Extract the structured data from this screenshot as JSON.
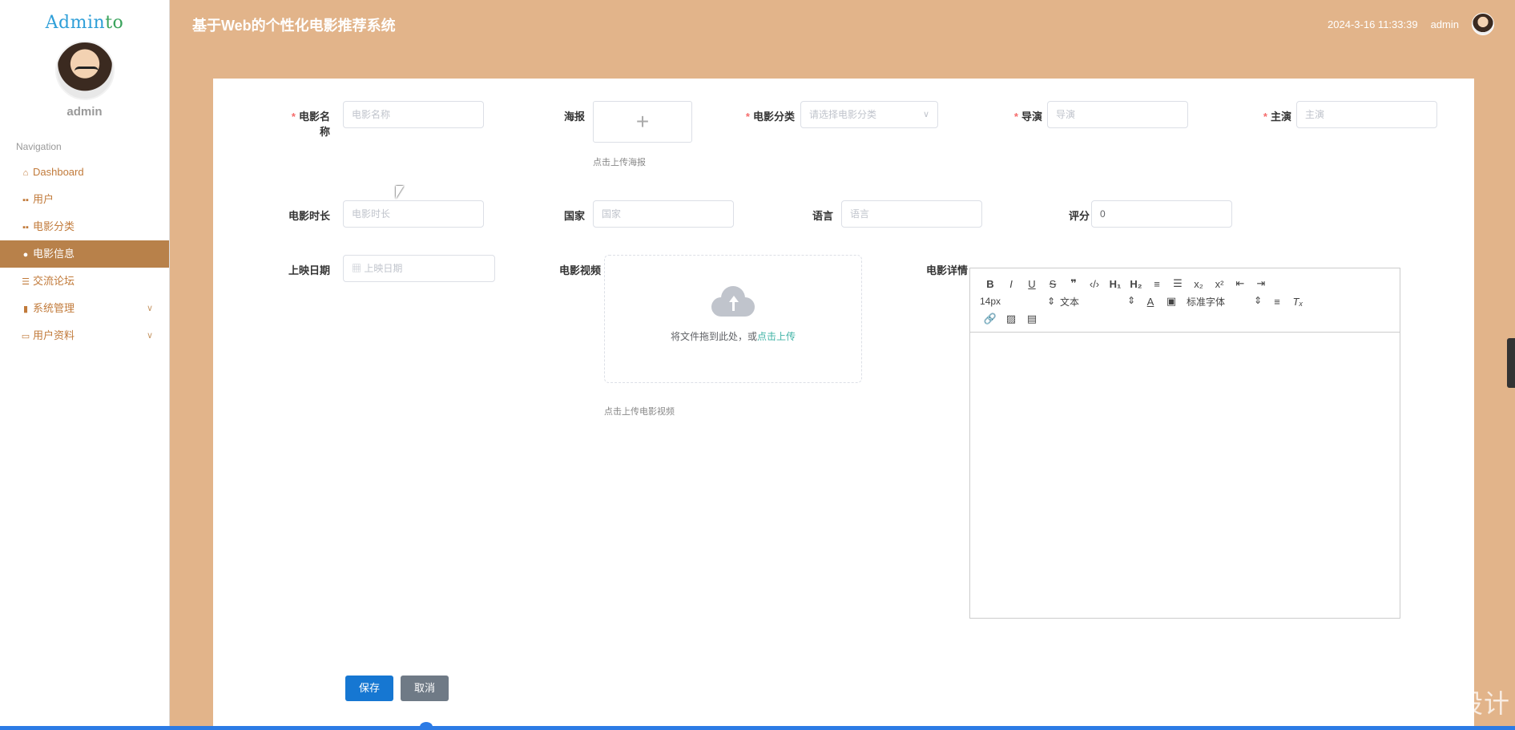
{
  "sidebar": {
    "logo_main": "Admin",
    "logo_accent": "to",
    "user_name": "admin",
    "nav_title": "Navigation",
    "items": [
      {
        "label": "Dashboard",
        "icon": "home-icon"
      },
      {
        "label": "用户",
        "icon": "grid-icon"
      },
      {
        "label": "电影分类",
        "icon": "grid-icon"
      },
      {
        "label": "电影信息",
        "icon": "user-icon",
        "active": true
      },
      {
        "label": "交流论坛",
        "icon": "list-icon"
      },
      {
        "label": "系统管理",
        "icon": "chart-icon",
        "expandable": true
      },
      {
        "label": "用户资料",
        "icon": "card-icon",
        "expandable": true
      }
    ]
  },
  "header": {
    "title": "基于Web的个性化电影推荐系统",
    "datetime": "2024-3-16 11:33:39",
    "username": "admin"
  },
  "form": {
    "movie_name": {
      "label": "电影名称",
      "placeholder": "电影名称"
    },
    "poster": {
      "label": "海报",
      "hint": "点击上传海报"
    },
    "category": {
      "label": "电影分类",
      "placeholder": "请选择电影分类"
    },
    "director": {
      "label": "导演",
      "placeholder": "导演"
    },
    "actors": {
      "label": "主演",
      "placeholder": "主演"
    },
    "duration": {
      "label": "电影时长",
      "placeholder": "电影时长"
    },
    "country": {
      "label": "国家",
      "placeholder": "国家"
    },
    "language": {
      "label": "语言",
      "placeholder": "语言"
    },
    "rating": {
      "label": "评分",
      "value": "0"
    },
    "release_date": {
      "label": "上映日期",
      "placeholder": "上映日期"
    },
    "video": {
      "label": "电影视频",
      "drop_text": "将文件拖到此处，或",
      "click_text": "点击上传",
      "hint": "点击上传电影视频"
    },
    "details": {
      "label": "电影详情"
    }
  },
  "editor": {
    "font_size": "14px",
    "block_type": "文本",
    "font_family": "标准字体"
  },
  "buttons": {
    "save": "保存",
    "cancel": "取消"
  },
  "watermark": "CSDN @便捷程序设计"
}
